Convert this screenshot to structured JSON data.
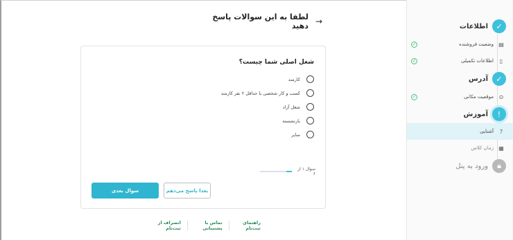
{
  "header": {
    "title": "لطفا به این سوالات پاسخ دهید",
    "back_icon": "arrow-right-icon"
  },
  "sidebar": {
    "steps": [
      {
        "label": "اطلاعات",
        "state": "done",
        "icon": "check-icon"
      },
      {
        "label": "آدرس",
        "state": "done",
        "icon": "check-icon"
      },
      {
        "label": "آموزش",
        "state": "active",
        "icon": "info-icon"
      },
      {
        "label": "ورود به پنل",
        "state": "locked",
        "icon": "lock-icon"
      }
    ],
    "subs": [
      {
        "label": "وضعیت فروشنده",
        "icon": "store-icon",
        "done": true
      },
      {
        "label": "اطلاعات تکمیلی",
        "icon": "document-icon",
        "done": true
      },
      {
        "label": "موقعیت مکانی",
        "icon": "location-pin-icon",
        "done": true
      },
      {
        "label": "آشنایی",
        "icon": "question-icon",
        "active": true
      },
      {
        "label": "زمان کلاس",
        "icon": "calendar-icon",
        "muted": true
      }
    ]
  },
  "card": {
    "question": "شغل اصلی شما چیست؟",
    "options": [
      "کارمند",
      "کسب و کار شخصی با حداقل ۲ نفر کارمند",
      "شغل آزاد",
      "بازنشسته",
      "سایر"
    ],
    "progress_text": "سوال ۱ از ۶",
    "progress_fraction": 0.1667,
    "next_label": "سوال بعدی",
    "later_label": "بعدا پاسخ می‌دهم"
  },
  "footer": {
    "links": [
      "راهنمای ثبت‌نام",
      "تماس با پشتیبانی",
      "انصراف از ثبت‌نام"
    ]
  },
  "colors": {
    "accent": "#3dc1dc",
    "success": "#4cc27a",
    "link": "#2a8a5a"
  }
}
